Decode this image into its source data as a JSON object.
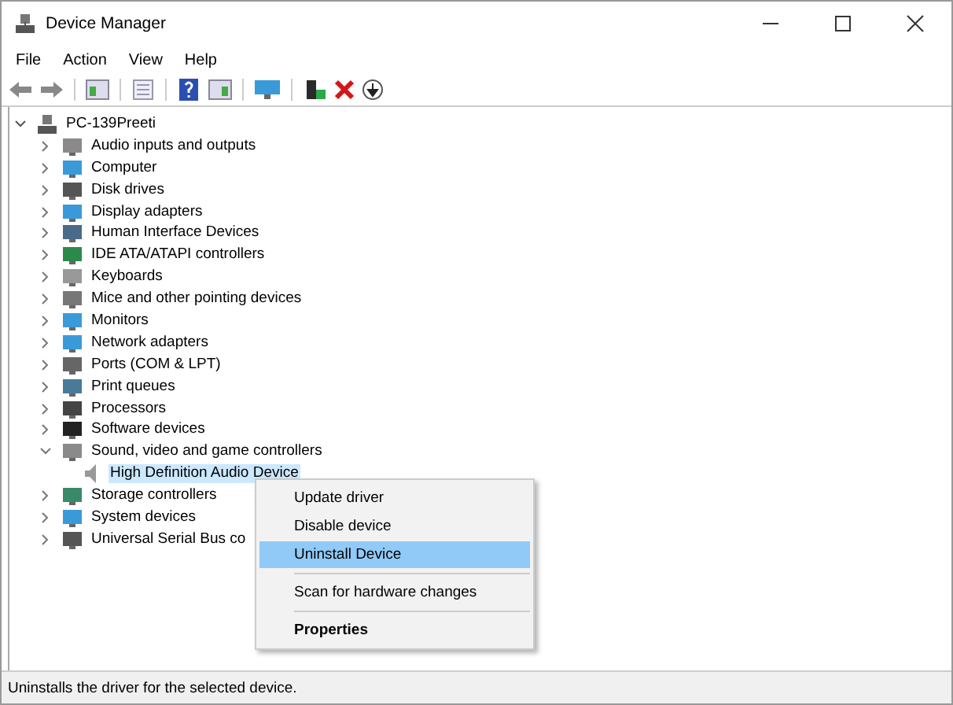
{
  "window": {
    "title": "Device Manager"
  },
  "menu_bar": [
    "File",
    "Action",
    "View",
    "Help"
  ],
  "tree": {
    "label": "PC-139Preeti",
    "expanded": true,
    "children": [
      {
        "label": "Audio inputs and outputs",
        "expanded": false,
        "selected": false
      },
      {
        "label": "Computer",
        "expanded": false,
        "selected": false
      },
      {
        "label": "Disk drives",
        "expanded": false,
        "selected": false
      },
      {
        "label": "Display adapters",
        "expanded": false,
        "selected": false
      },
      {
        "label": "Human Interface Devices",
        "expanded": false,
        "selected": false
      },
      {
        "label": "IDE ATA/ATAPI controllers",
        "expanded": false,
        "selected": false
      },
      {
        "label": "Keyboards",
        "expanded": false,
        "selected": false
      },
      {
        "label": "Mice and other pointing devices",
        "expanded": false,
        "selected": false
      },
      {
        "label": "Monitors",
        "expanded": false,
        "selected": false
      },
      {
        "label": "Network adapters",
        "expanded": false,
        "selected": false
      },
      {
        "label": "Ports (COM & LPT)",
        "expanded": false,
        "selected": false
      },
      {
        "label": "Print queues",
        "expanded": false,
        "selected": false
      },
      {
        "label": "Processors",
        "expanded": false,
        "selected": false
      },
      {
        "label": "Software devices",
        "expanded": false,
        "selected": false
      },
      {
        "label": "Sound, video and game controllers",
        "expanded": true,
        "selected": false,
        "children": [
          {
            "label": "High Definition Audio Device",
            "selected": true
          }
        ]
      },
      {
        "label": "Storage controllers",
        "expanded": false,
        "selected": false
      },
      {
        "label": "System devices",
        "expanded": false,
        "selected": false
      },
      {
        "label": "Universal Serial Bus co",
        "expanded": false,
        "selected": false
      }
    ]
  },
  "context_menu": [
    {
      "label": "Update driver",
      "selected": false,
      "separator_before": false,
      "default": false
    },
    {
      "label": "Disable device",
      "selected": false,
      "separator_before": false,
      "default": false
    },
    {
      "label": "Uninstall Device",
      "selected": true,
      "separator_before": false,
      "default": false
    },
    {
      "label": "Scan for hardware changes",
      "selected": false,
      "separator_before": true,
      "default": false
    },
    {
      "label": "Properties",
      "selected": false,
      "separator_before": true,
      "default": true
    }
  ],
  "status_bar": "Uninstalls the driver for the selected device."
}
